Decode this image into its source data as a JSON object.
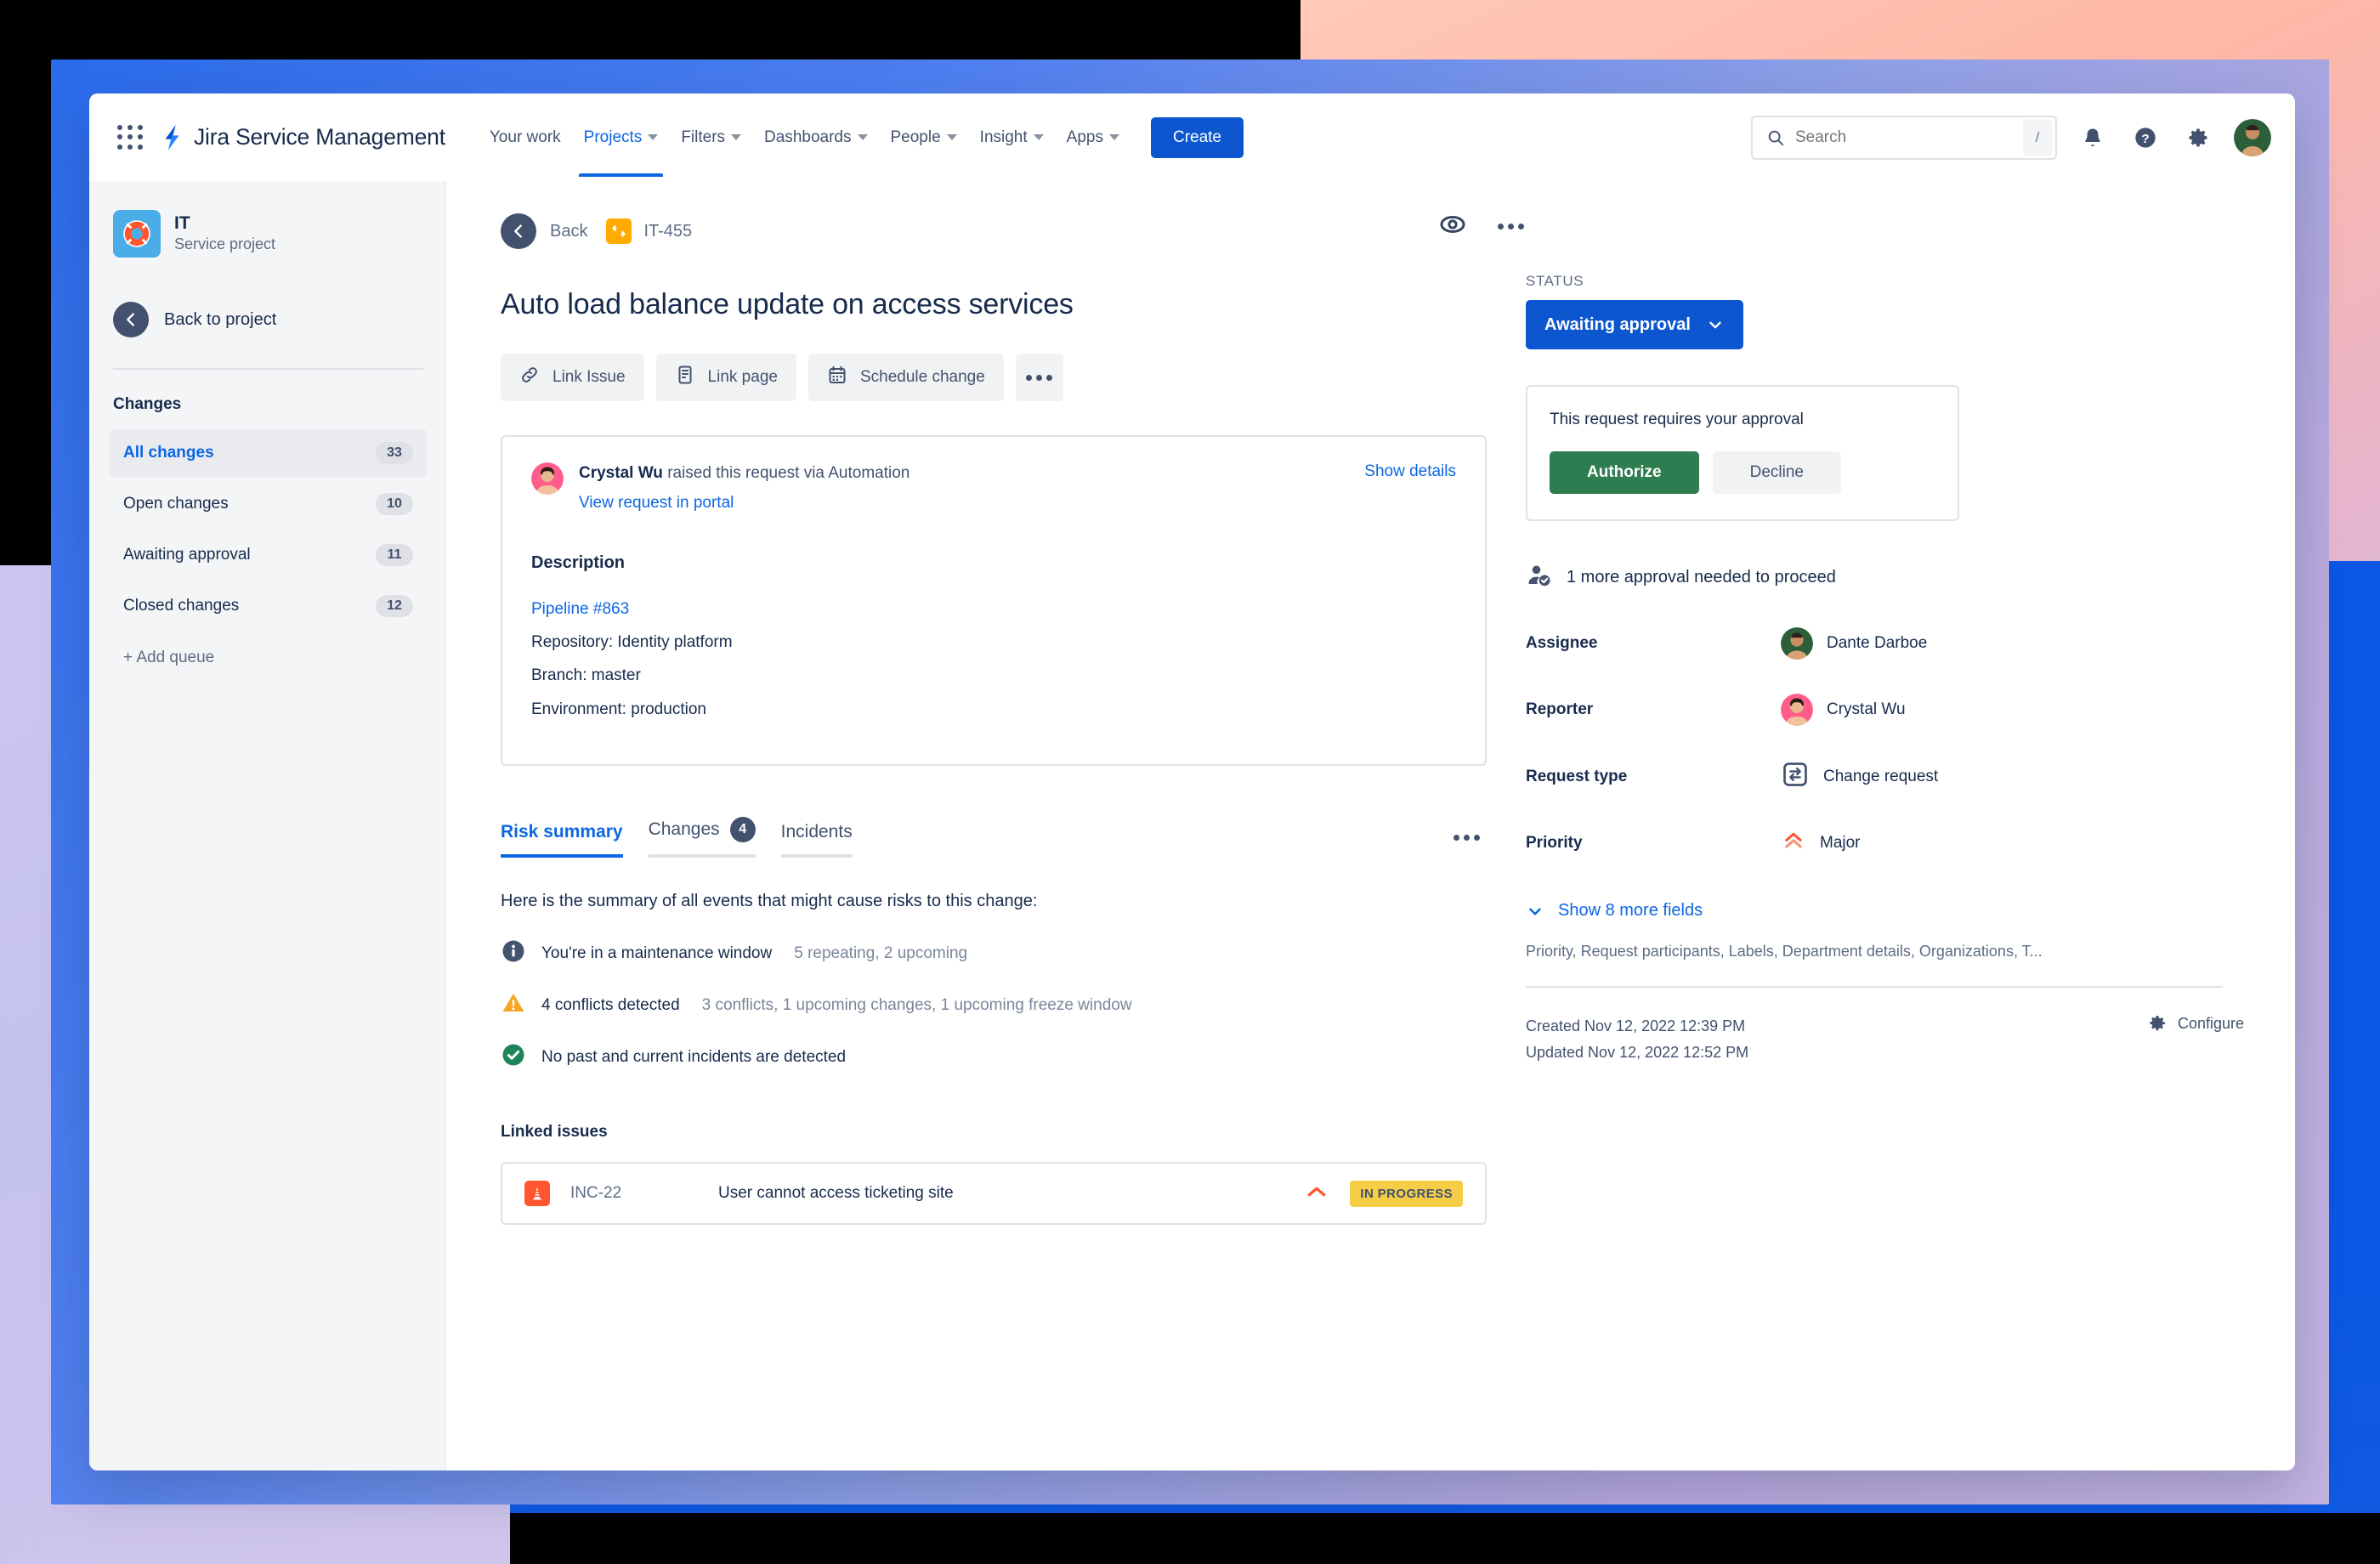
{
  "topnav": {
    "app_grid_icon": "app-switcher-icon",
    "brand_name": "Jira Service Management",
    "nav_items": [
      {
        "label": "Your work",
        "has_caret": false,
        "active": false
      },
      {
        "label": "Projects",
        "has_caret": true,
        "active": true
      },
      {
        "label": "Filters",
        "has_caret": true,
        "active": false
      },
      {
        "label": "Dashboards",
        "has_caret": true,
        "active": false
      },
      {
        "label": "People",
        "has_caret": true,
        "active": false
      },
      {
        "label": "Insight",
        "has_caret": true,
        "active": false
      },
      {
        "label": "Apps",
        "has_caret": true,
        "active": false
      }
    ],
    "create_label": "Create",
    "search_placeholder": "Search",
    "search_value": "",
    "search_shortcut": "/",
    "notifications_icon": "bell-icon",
    "help_icon": "help-icon",
    "settings_icon": "gear-icon",
    "profile_icon": "avatar"
  },
  "sidebar": {
    "project_name": "IT",
    "project_type": "Service project",
    "back_to_project": "Back to project",
    "section_title": "Changes",
    "queues": [
      {
        "label": "All changes",
        "count": "33",
        "active": true
      },
      {
        "label": "Open changes",
        "count": "10",
        "active": false
      },
      {
        "label": "Awaiting approval",
        "count": "11",
        "active": false
      },
      {
        "label": "Closed changes",
        "count": "12",
        "active": false
      }
    ],
    "add_queue": "+ Add queue"
  },
  "content": {
    "back_label": "Back",
    "issue_key": "IT-455",
    "title": "Auto load balance update on access services",
    "actions": [
      {
        "label": "Link Issue",
        "icon": "link-icon"
      },
      {
        "label": "Link page",
        "icon": "page-icon"
      },
      {
        "label": "Schedule change",
        "icon": "calendar-icon"
      }
    ],
    "more_actions_icon": "more-actions-icon",
    "watch_icon": "watch-eye-icon",
    "header_more_icon": "more-actions-icon",
    "request": {
      "reporter": "Crystal Wu",
      "raised_text": "raised this request via Automation",
      "portal_link": "View request in portal",
      "show_details": "Show details"
    },
    "description": {
      "heading": "Description",
      "pipeline_link": "Pipeline #863",
      "lines": [
        "Repository: Identity platform",
        "Branch: master",
        "Environment: production"
      ]
    },
    "tabs": [
      {
        "label": "Risk summary",
        "count": null,
        "active": true
      },
      {
        "label": "Changes",
        "count": "4",
        "active": false
      },
      {
        "label": "Incidents",
        "count": null,
        "active": false
      }
    ],
    "tabs_more_icon": "more-actions-icon",
    "risk": {
      "intro": "Here is the summary of all events that might cause risks to this change:",
      "items": [
        {
          "icon": "info-icon",
          "main": "You're in a maintenance window",
          "sub": "5 repeating, 2 upcoming"
        },
        {
          "icon": "warning-icon",
          "main": "4 conflicts detected",
          "sub": "3 conflicts, 1 upcoming changes, 1 upcoming freeze window"
        },
        {
          "icon": "success-icon",
          "main": "No past and current incidents are detected",
          "sub": ""
        }
      ]
    },
    "linked_issues": {
      "title": "Linked issues",
      "rows": [
        {
          "icon": "incident-icon",
          "key": "INC-22",
          "summary": "User cannot access ticketing site",
          "priority_icon": "priority-high-icon",
          "status": "IN PROGRESS"
        }
      ]
    }
  },
  "details": {
    "status_label": "STATUS",
    "status_value": "Awaiting approval",
    "approval": {
      "prompt": "This request requires your approval",
      "authorize_label": "Authorize",
      "decline_label": "Decline"
    },
    "approval_note": "1 more approval needed to proceed",
    "fields": [
      {
        "label": "Assignee",
        "value": "Dante Darboe",
        "icon": "avatar-dante"
      },
      {
        "label": "Reporter",
        "value": "Crystal Wu",
        "icon": "avatar-crystal"
      },
      {
        "label": "Request type",
        "value": "Change request",
        "icon": "change-request-icon"
      },
      {
        "label": "Priority",
        "value": "Major",
        "icon": "priority-major-icon"
      }
    ],
    "show_more_label": "Show 8 more fields",
    "hidden_fields": "Priority, Request participants, Labels, Department details, Organizations, T...",
    "created": "Created Nov 12, 2022 12:39 PM",
    "updated": "Updated Nov 12, 2022 12:52 PM",
    "configure_label": "Configure",
    "configure_icon": "gear-icon"
  },
  "colors": {
    "brand_blue": "#0c56d0",
    "link_blue": "#0c66e4",
    "authorize_green": "#2e7d50",
    "status_yellow": "#f5cd47",
    "warning_orange": "#ffab00",
    "incident_red": "#ff5630",
    "priority_major": "#ff7452"
  }
}
